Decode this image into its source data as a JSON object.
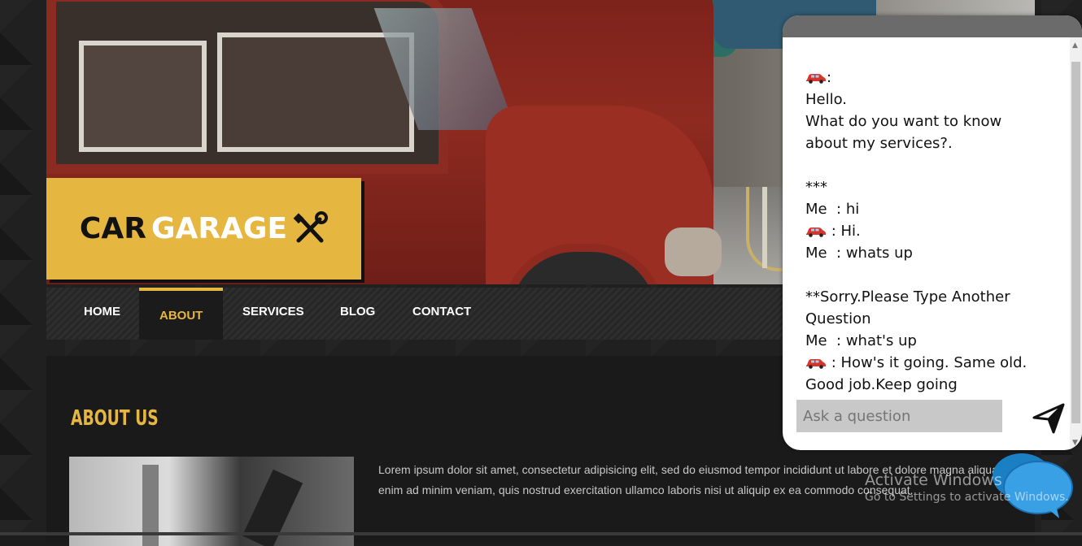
{
  "logo": {
    "part1": "CAR",
    "part2": "GARAGE",
    "icon": "wrench-screwdriver-icon"
  },
  "nav": {
    "items": [
      {
        "label": "HOME"
      },
      {
        "label": "ABOUT",
        "active": true
      },
      {
        "label": "SERVICES"
      },
      {
        "label": "BLOG"
      },
      {
        "label": "CONTACT"
      }
    ]
  },
  "about": {
    "title": "ABOUT US",
    "text": "Lorem ipsum dolor sit amet, consectetur adipisicing elit, sed do eiusmod tempor incididunt ut labore et dolore magna aliqua. Ut enim ad minim veniam, quis nostrud exercitation ullamco laboris nisi ut aliquip ex ea commodo consequat."
  },
  "chat": {
    "bot_icon": "car-icon",
    "lines": [
      {
        "car": true,
        "text": ":"
      },
      {
        "text": "Hello."
      },
      {
        "text": "What do you want to know about my services?."
      },
      {
        "text": ""
      },
      {
        "text": "***"
      },
      {
        "text": "Me  : hi"
      },
      {
        "car": true,
        "text": " : Hi."
      },
      {
        "text": "Me  : whats up"
      },
      {
        "text": ""
      },
      {
        "text": "**Sorry.Please Type Another Question"
      },
      {
        "text": "Me  : what's up"
      },
      {
        "car": true,
        "text": " : How's it going. Same old. Good job.Keep going"
      }
    ],
    "input_placeholder": "Ask a question",
    "send_icon": "send-icon"
  },
  "watermark": {
    "line1": "Activate Windows",
    "line2": "Go to Settings to activate Windows."
  },
  "colors": {
    "accent": "#e6b740",
    "background": "#1c1c1c"
  }
}
